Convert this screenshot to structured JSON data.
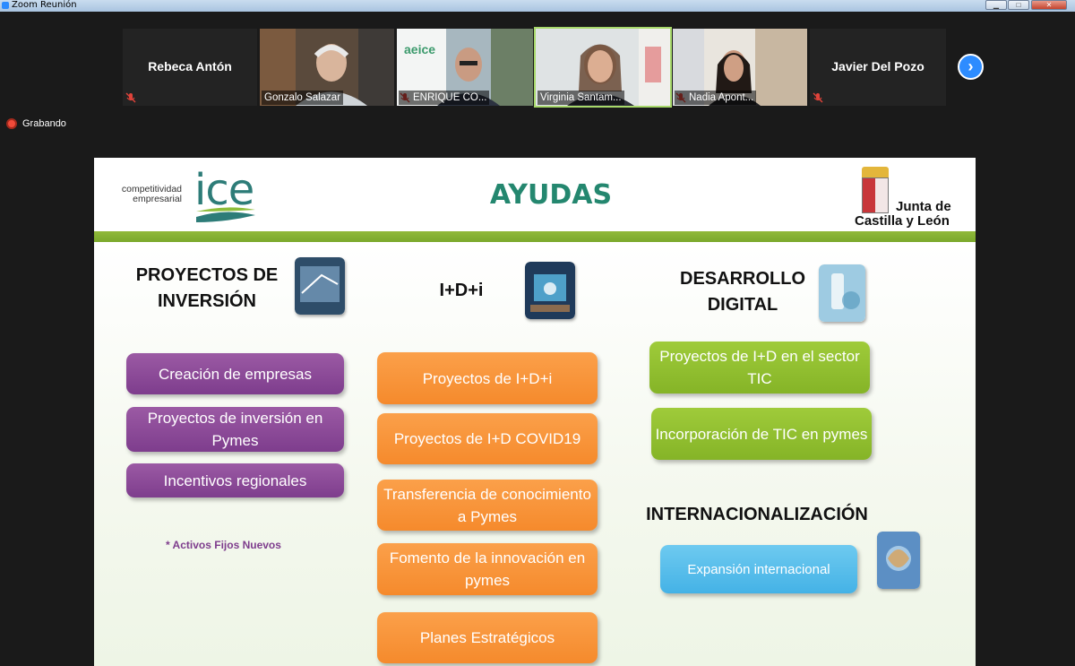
{
  "window": {
    "title": "Zoom Reunión",
    "minimize": "▁",
    "maximize": "□",
    "close": "✕"
  },
  "participants": [
    {
      "name": "Rebeca Antón",
      "type": "name-only",
      "muted": true
    },
    {
      "name": "Gonzalo Salazar",
      "type": "video",
      "muted": false
    },
    {
      "name": "ENRIQUE CO...",
      "type": "video",
      "muted": true
    },
    {
      "name": "Virginia Santam...",
      "type": "video",
      "muted": false,
      "active": true
    },
    {
      "name": "Nadia Apont...",
      "type": "video",
      "muted": true
    },
    {
      "name": "Javier Del Pozo",
      "type": "name-only",
      "muted": true
    }
  ],
  "next_button": "›",
  "recording": {
    "label": "Grabando"
  },
  "slide": {
    "title": "AYUDAS",
    "logo_left": {
      "small_text": "competitividad empresarial",
      "big_text": "ice"
    },
    "logo_right": {
      "line1": "Junta de",
      "line2": "Castilla y León"
    },
    "columns": {
      "inversion": {
        "heading": [
          "PROYECTOS DE",
          "INVERSIÓN"
        ],
        "items": [
          "Creación de empresas",
          "Proyectos de inversión en Pymes",
          "Incentivos regionales"
        ],
        "note": "* Activos Fijos Nuevos"
      },
      "idi": {
        "heading": [
          "I+D+i"
        ],
        "items": [
          "Proyectos de I+D+i",
          "Proyectos de I+D COVID19",
          "Transferencia de conocimiento a Pymes",
          "Fomento de la innovación en pymes",
          "Planes Estratégicos"
        ]
      },
      "digital": {
        "heading": [
          "DESARROLLO",
          "DIGITAL"
        ],
        "items": [
          "Proyectos de I+D en el sector TIC",
          "Incorporación de TIC en pymes"
        ]
      },
      "internacional": {
        "heading": "INTERNACIONALIZACIÓN",
        "items": [
          "Expansión internacional"
        ]
      }
    }
  },
  "colors": {
    "purple": "#7e3d8d",
    "orange": "#f58a2c",
    "green": "#85b427",
    "blue": "#44b2e6",
    "title": "#24876f",
    "zoom_blue": "#2d8cff"
  }
}
